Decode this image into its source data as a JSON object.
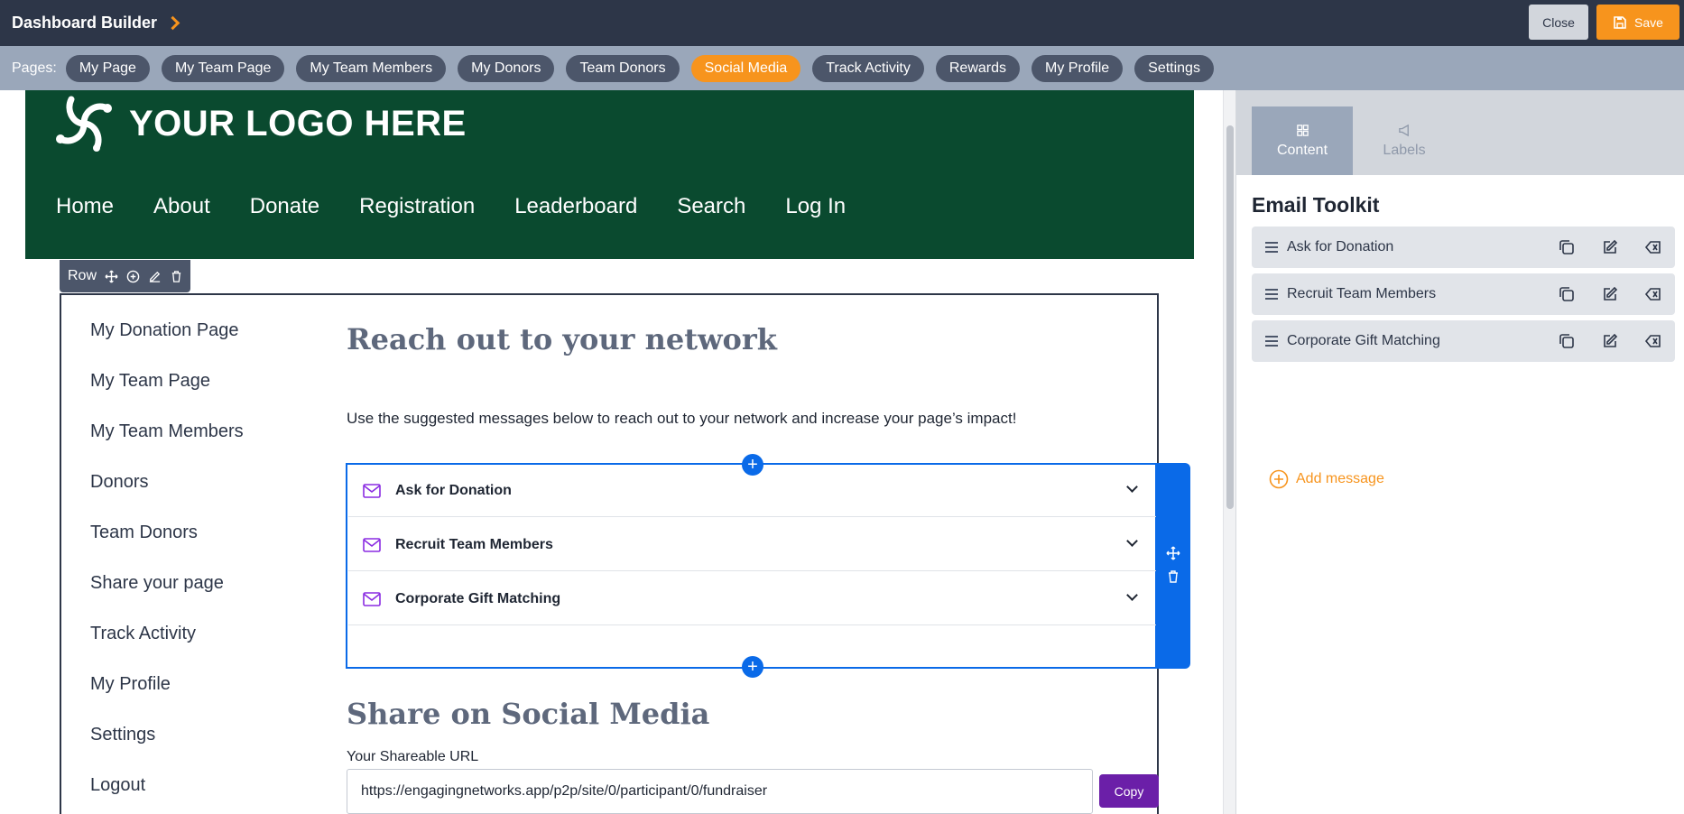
{
  "app": {
    "title": "Dashboard Builder"
  },
  "toolbar": {
    "close_label": "Close",
    "save_label": "Save"
  },
  "pagesbar": {
    "label": "Pages:",
    "pages": [
      "My Page",
      "My Team Page",
      "My Team Members",
      "My Donors",
      "Team Donors",
      "Social Media",
      "Track Activity",
      "Rewards",
      "My Profile",
      "Settings"
    ],
    "active": "Social Media"
  },
  "hero": {
    "logo_text": "YOUR LOGO HERE",
    "nav": [
      "Home",
      "About",
      "Donate",
      "Registration",
      "Leaderboard",
      "Search",
      "Log In"
    ]
  },
  "row_tag": {
    "label": "Row"
  },
  "sidenav": [
    "My Donation Page",
    "My Team Page",
    "My Team Members",
    "Donors",
    "Team Donors",
    "Share your page",
    "Track Activity",
    "My Profile",
    "Settings",
    "Logout"
  ],
  "main": {
    "heading": "Reach out to your network",
    "intro": "Use the suggested messages below to reach out to your network and increase your page’s impact!",
    "accordion": [
      "Ask for Donation",
      "Recruit Team Members",
      "Corporate Gift Matching"
    ],
    "share_heading": "Share on Social Media",
    "url_label": "Your Shareable URL",
    "url_value": "https://engagingnetworks.app/p2p/site/0/participant/0/fundraiser",
    "copy_label": "Copy"
  },
  "panel": {
    "tabs": [
      "Content",
      "Labels"
    ],
    "heading": "Email Toolkit",
    "messages": [
      "Ask for Donation",
      "Recruit Team Members",
      "Corporate Gift Matching"
    ],
    "add_label": "Add message"
  },
  "colors": {
    "accent": "#f7941d",
    "primary_blue": "#0a6ae8",
    "hero_green": "#0a4a2f",
    "copy_purple": "#6b1fa8",
    "topbar": "#2d3648"
  }
}
